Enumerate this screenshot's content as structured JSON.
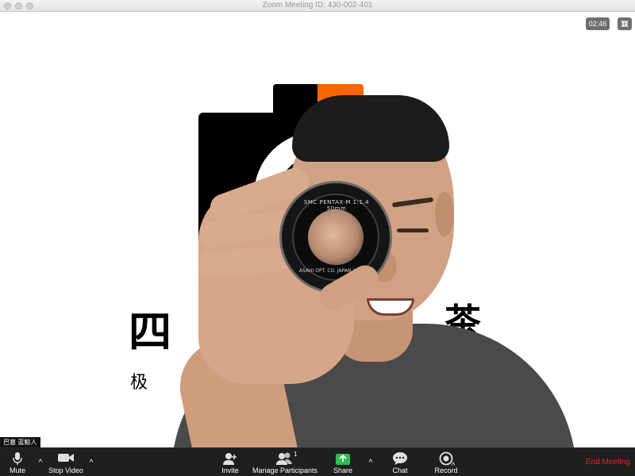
{
  "window": {
    "title": "Zoom Meeting ID: 430-002-401"
  },
  "overlay": {
    "timer": "02:46",
    "fullscreen_icon": "fullscreen-exit-icon"
  },
  "background_logo": {
    "glyph_left": "四",
    "glyph_right": "茶",
    "subline": "极 速"
  },
  "lens": {
    "label_top": "SMC PENTAX-M 1:1.4 50mm",
    "label_bottom": "ASAHI OPT. CO. JAPAN 2232102"
  },
  "participant": {
    "name": "巴塞 蓝鲸人"
  },
  "toolbar": {
    "mute_label": "Mute",
    "stop_video_label": "Stop Video",
    "invite_label": "Invite",
    "manage_participants_label": "Manage Participants",
    "participants_count": "1",
    "share_label": "Share",
    "chat_label": "Chat",
    "record_label": "Record",
    "end_meeting_label": "End Meeting",
    "caret": "^"
  },
  "colors": {
    "toolbar_bg": "#1f1f1f",
    "share_green": "#2fbd4c",
    "end_meeting_red": "#e02828",
    "logo_orange": "#ff6600"
  }
}
